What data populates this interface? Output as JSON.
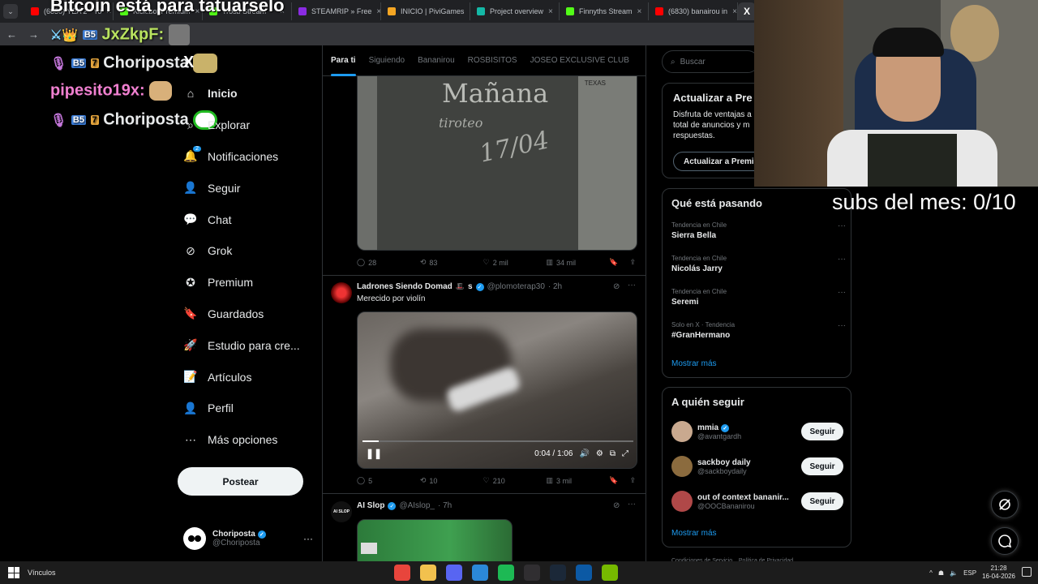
{
  "browser": {
    "tabs": [
      {
        "label": "(6830) YEA 2 - Yo",
        "color": "#ff0000"
      },
      {
        "label": "Kick.bot Premium",
        "color": "#53fc18"
      },
      {
        "label": "Trosb Stream",
        "color": "#53fc18"
      },
      {
        "label": "STEAMRIP » Free",
        "color": "#8a2be2"
      },
      {
        "label": "INICIO | PiviGames",
        "color": "#f5a623"
      },
      {
        "label": "Project overview",
        "color": "#14b8a6"
      },
      {
        "label": "Finnyths Stream",
        "color": "#53fc18"
      },
      {
        "label": "(6830) banairou in",
        "color": "#ff0000"
      }
    ],
    "active_tab_icon": "X"
  },
  "overlay": {
    "banner": "Bitcoin está para tatuarselo",
    "chat": [
      {
        "user": "JxZkpF:",
        "color": "#b9e35f"
      },
      {
        "user": "Choriposta",
        "color": "#ffffff"
      },
      {
        "user": "pipesito19x:",
        "color": "#f080d0"
      },
      {
        "user": "Choriposta",
        "color": "#ffffff"
      }
    ],
    "subs": "subs del mes: 0/10"
  },
  "nav": {
    "items": [
      {
        "label": "Inicio"
      },
      {
        "label": "Explorar"
      },
      {
        "label": "Notificaciones",
        "badge": "2"
      },
      {
        "label": "Seguir"
      },
      {
        "label": "Chat"
      },
      {
        "label": "Grok"
      },
      {
        "label": "Premium"
      },
      {
        "label": "Guardados"
      },
      {
        "label": "Estudio para cre..."
      },
      {
        "label": "Artículos"
      },
      {
        "label": "Perfil"
      },
      {
        "label": "Más opciones"
      }
    ],
    "post_button": "Postear",
    "account": {
      "name": "Choriposta",
      "handle": "@Choriposta"
    }
  },
  "feed": {
    "tabs": [
      "Para ti",
      "Siguiendo",
      "Bananirou",
      "ROSBISITOS",
      "JOSEO EXCLUSIVE CLUB"
    ],
    "image_text": {
      "line1": "Mañana",
      "line2": "tiroteo",
      "line3": "17/04",
      "line4": "TEXAS"
    },
    "tweet1_stats": {
      "replies": "28",
      "retweets": "83",
      "likes": "2 mil",
      "views": "34 mil"
    },
    "tweet2": {
      "name": "Ladrones Siendo Domad",
      "name_suffix": "s",
      "handle": "@plomoterap30",
      "time": "· 2h",
      "text": "Merecido por violín",
      "video_time": "0:04 / 1:06",
      "progress": 0.06,
      "stats": {
        "replies": "5",
        "retweets": "10",
        "likes": "210",
        "views": "3 mil"
      }
    },
    "tweet3": {
      "name": "AI Slop",
      "handle": "@AIslop_",
      "time": "· 7h",
      "avatar_text": "AI SLOP"
    }
  },
  "sidebar": {
    "search_placeholder": "Buscar",
    "premium": {
      "title": "Actualizar a Pre",
      "text1": "Disfruta de ventajas a",
      "text2": "total de anuncios y m",
      "text3": "respuestas.",
      "button": "Actualizar a Premi"
    },
    "trending": {
      "title": "Qué está pasando",
      "items": [
        {
          "context": "Tendencia en Chile",
          "topic": "Sierra Bella"
        },
        {
          "context": "Tendencia en Chile",
          "topic": "Nicolás Jarry"
        },
        {
          "context": "Tendencia en Chile",
          "topic": "Seremi"
        },
        {
          "context": "Solo en X · Tendencia",
          "topic": "#GranHermano"
        }
      ],
      "more": "Mostrar más"
    },
    "who_to_follow": {
      "title": "A quién seguir",
      "users": [
        {
          "name": "mmia",
          "handle": "@avantgardh",
          "button": "Seguir",
          "color": "#c9a98f"
        },
        {
          "name": "sackboy daily",
          "handle": "@sackboydaily",
          "button": "Seguir",
          "color": "#8b6b3e"
        },
        {
          "name": "out of context bananir...",
          "handle": "@OOCBananirou",
          "button": "Seguir",
          "color": "#b04848"
        }
      ],
      "more": "Mostrar más"
    },
    "footer": "Condiciones de Servicio    Política de Privacidad"
  },
  "taskbar": {
    "start_label": "Vínculos",
    "language": "ESP",
    "time": "21:28",
    "date": "16-04-2026",
    "apps": [
      {
        "name": "chrome-icon",
        "color": "#e8453c"
      },
      {
        "name": "explorer-icon",
        "color": "#f2c14e"
      },
      {
        "name": "discord-icon",
        "color": "#5865f2"
      },
      {
        "name": "store-icon",
        "color": "#2b88d8"
      },
      {
        "name": "spotify-icon",
        "color": "#1db954"
      },
      {
        "name": "obs-icon",
        "color": "#302e31"
      },
      {
        "name": "steam-icon",
        "color": "#1b2838"
      },
      {
        "name": "edge-icon",
        "color": "#0c59a4"
      },
      {
        "name": "nvidia-icon",
        "color": "#76b900"
      }
    ]
  },
  "colors": {
    "accent": "#1d9bf0",
    "verified": "#1d9bf0",
    "background": "#000000"
  }
}
